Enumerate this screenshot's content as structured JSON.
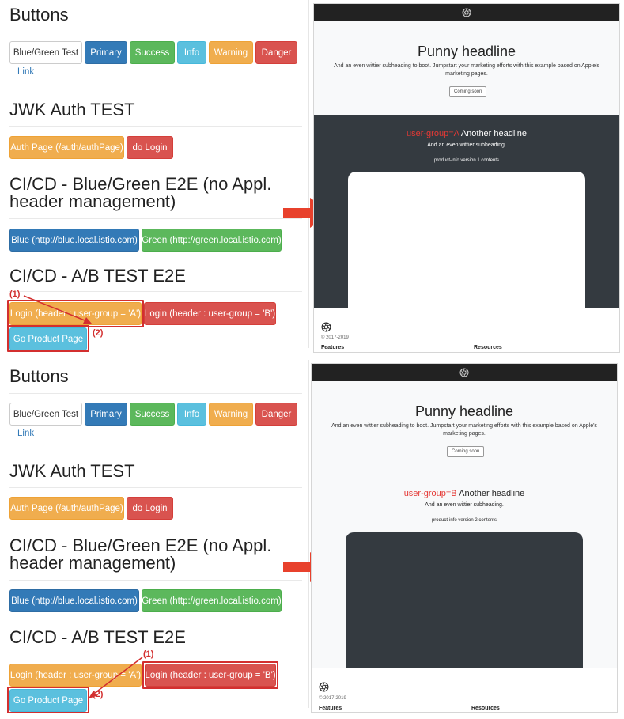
{
  "panels": [
    {
      "buttons_heading": "Buttons",
      "buttons": [
        "Blue/Green Test",
        "Primary",
        "Success",
        "Info",
        "Warning",
        "Danger"
      ],
      "link_label": "Link",
      "jwk_heading": "JWK Auth TEST",
      "jwk_buttons": [
        "Auth Page (/auth/authPage)",
        "do Login"
      ],
      "bg_heading_line1": "CI/CD - Blue/Green E2E (no Appl.",
      "bg_heading_line2": "header management)",
      "bg_buttons": [
        "Blue (http://blue.local.istio.com)",
        "Green (http://green.local.istio.com)"
      ],
      "ab_heading": "CI/CD - A/B TEST E2E",
      "ab_buttons": [
        "Login (header : user-group = 'A')",
        "Login (header : user-group = 'B')"
      ],
      "go_product": "Go Product Page",
      "annotations": [
        "(1)",
        "(2)"
      ],
      "screenshot": {
        "hero_title": "Punny headline",
        "hero_sub": "And an even wittier subheading to boot. Jumpstart your marketing efforts with this example based on Apple's marketing pages.",
        "hero_button": "Coming soon",
        "group_label": "user-group=A",
        "feature_title": "Another headline",
        "feature_sub": "And an even wittier subheading.",
        "version": "product-info version 1 contents",
        "copyright": "© 2017-2019",
        "footer_cols": [
          "Features",
          "Resources"
        ]
      }
    },
    {
      "buttons_heading": "Buttons",
      "buttons": [
        "Blue/Green Test",
        "Primary",
        "Success",
        "Info",
        "Warning",
        "Danger"
      ],
      "link_label": "Link",
      "jwk_heading": "JWK Auth TEST",
      "jwk_buttons": [
        "Auth Page (/auth/authPage)",
        "do Login"
      ],
      "bg_heading_line1": "CI/CD - Blue/Green E2E (no Appl.",
      "bg_heading_line2": "header management)",
      "bg_buttons": [
        "Blue (http://blue.local.istio.com)",
        "Green (http://green.local.istio.com)"
      ],
      "ab_heading": "CI/CD - A/B TEST E2E",
      "ab_buttons": [
        "Login (header : user-group = 'A')",
        "Login (header : user-group = 'B')"
      ],
      "go_product": "Go Product Page",
      "annotations": [
        "(1)",
        "(2)"
      ],
      "screenshot": {
        "hero_title": "Punny headline",
        "hero_sub": "And an even wittier subheading to boot. Jumpstart your marketing efforts with this example based on Apple's marketing pages.",
        "hero_button": "Coming soon",
        "group_label": "user-group=B",
        "feature_title": "Another headline",
        "feature_sub": "And an even wittier subheading.",
        "version": "product-info version 2 contents",
        "copyright": "© 2017-2019",
        "footer_cols": [
          "Features",
          "Resources"
        ]
      }
    }
  ],
  "colors": {
    "default": "#ffffff",
    "primary": "#337ab7",
    "success": "#5cb85c",
    "info": "#5bc0de",
    "warning": "#f0ad4e",
    "danger": "#d9534f",
    "annotation": "#d32f2f",
    "arrow": "#e8412c"
  },
  "icons": [
    "aperture-logo-icon",
    "arrow-right-icon"
  ]
}
